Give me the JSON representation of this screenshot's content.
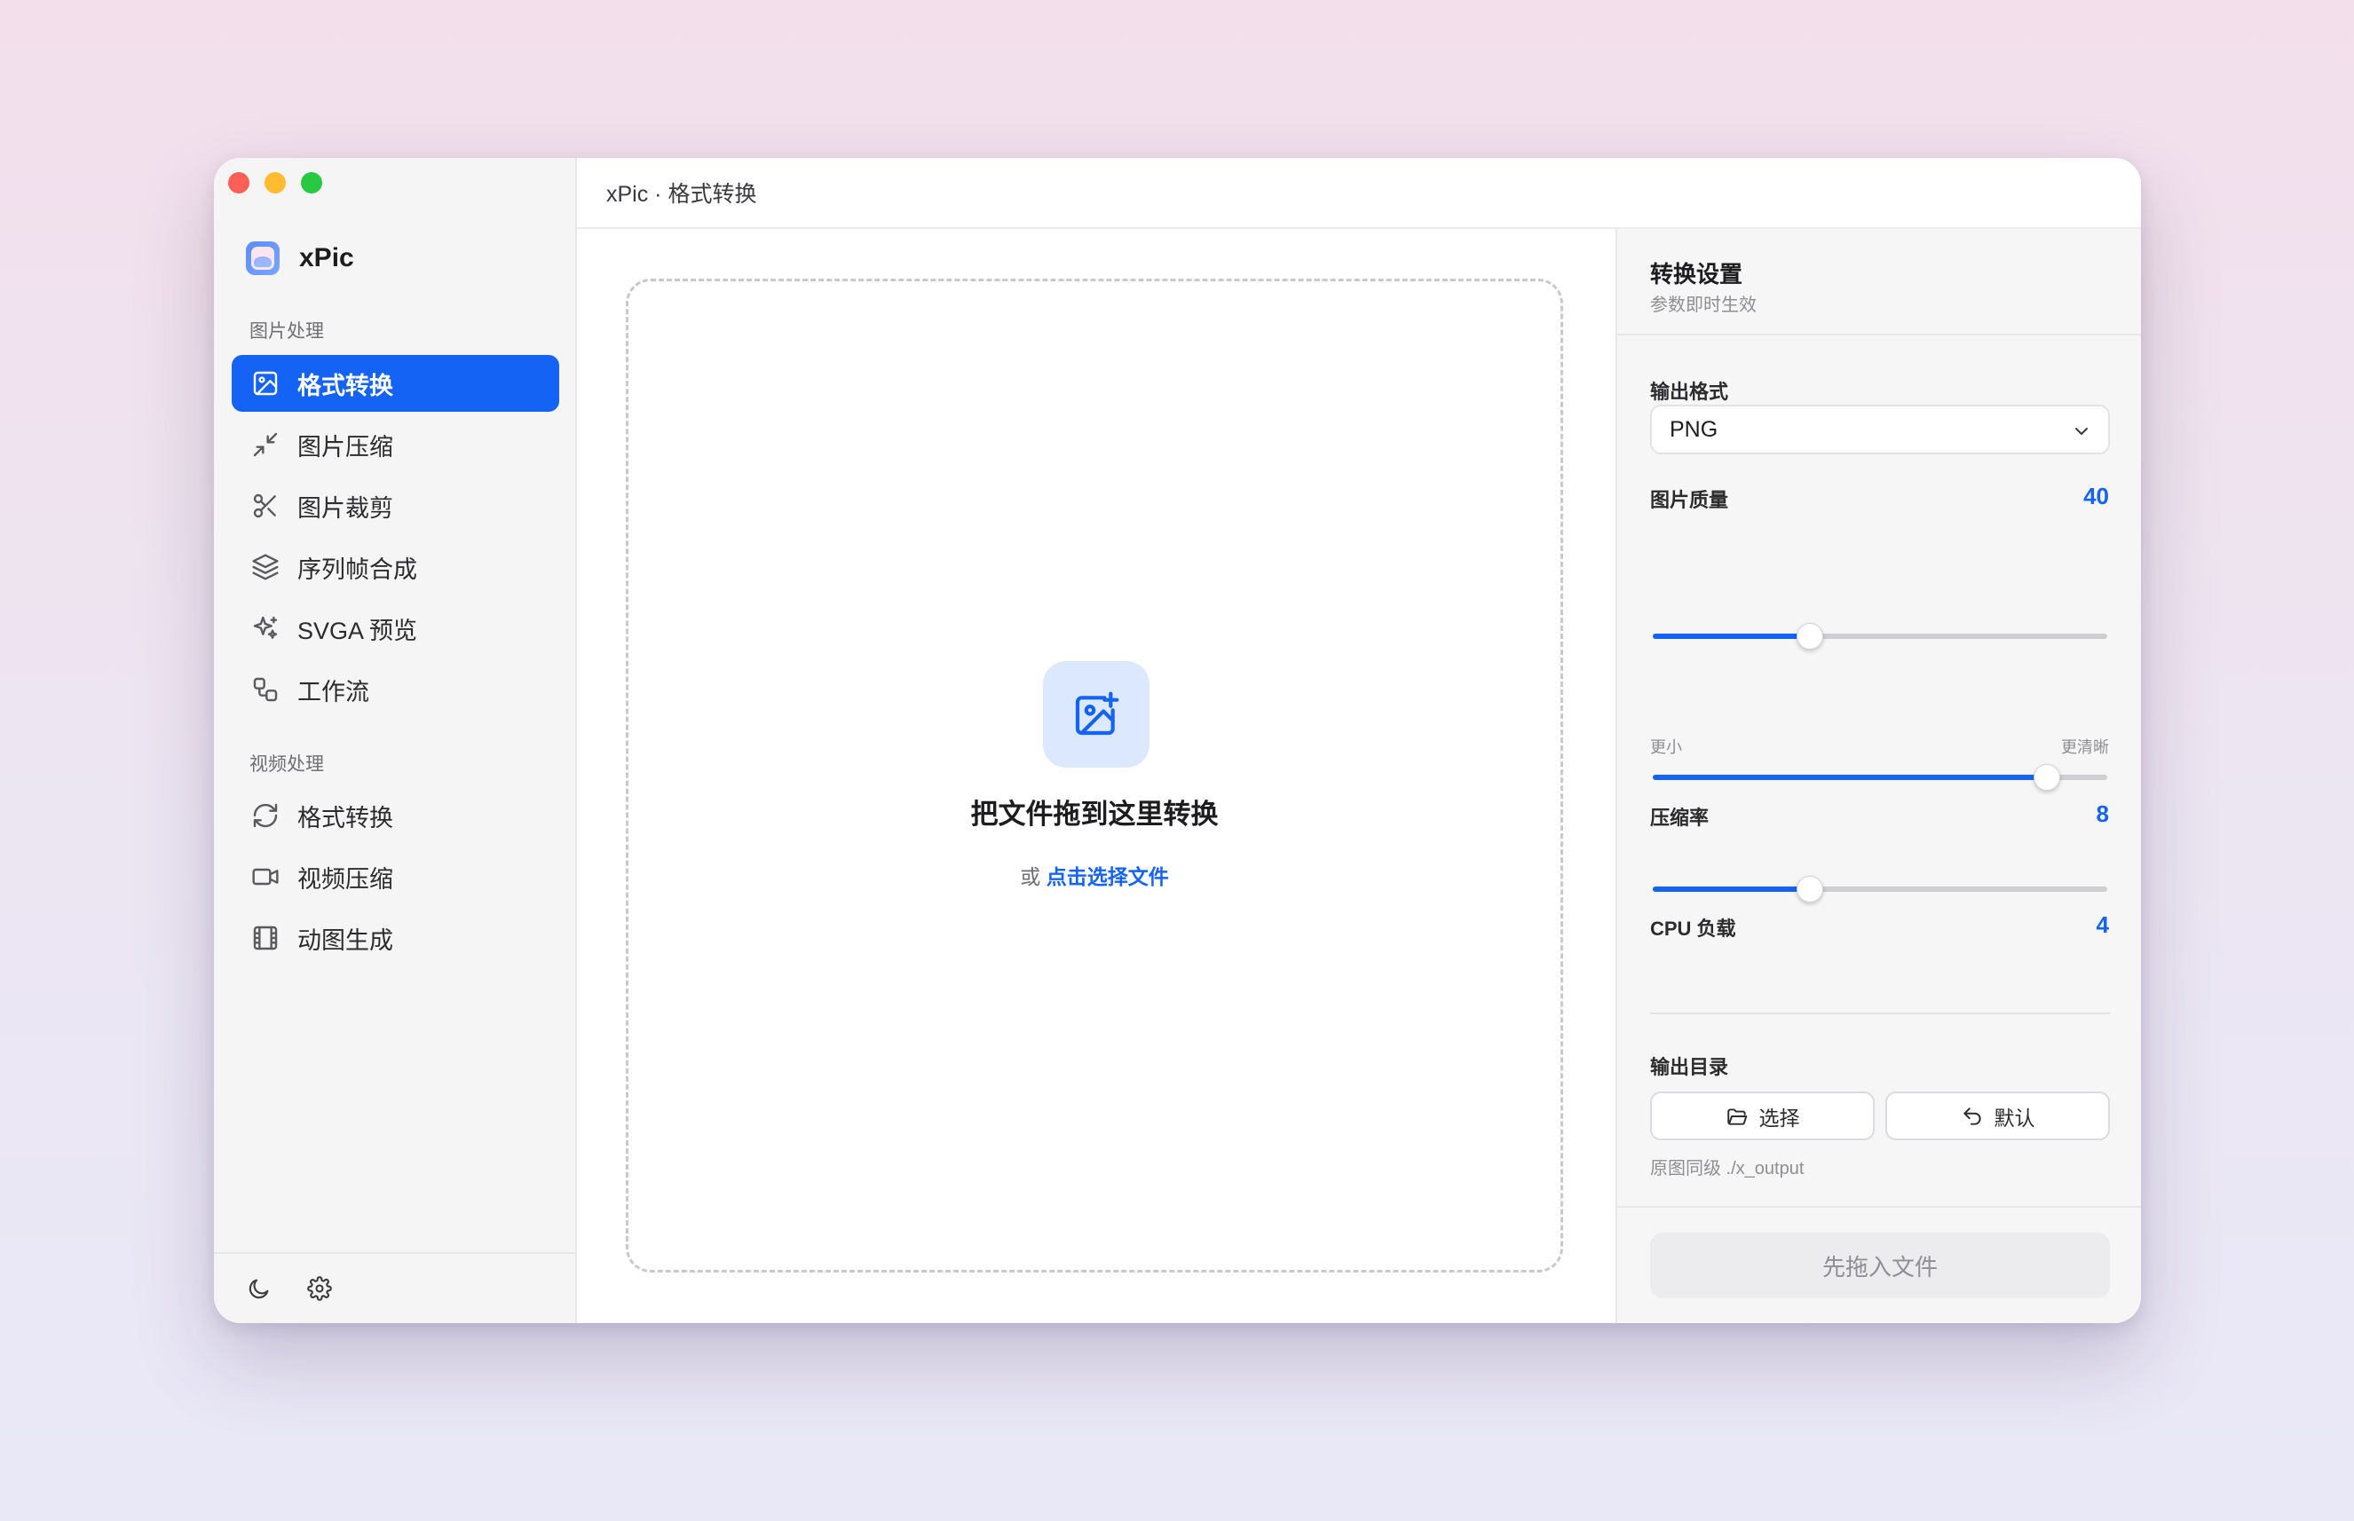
{
  "window": {
    "title": "xPic · 格式转换"
  },
  "sidebar": {
    "app_name": "xPic",
    "image_section_title": "图片处理",
    "image_items": [
      {
        "label": "格式转换",
        "icon": "image-icon",
        "active": true
      },
      {
        "label": "图片压缩",
        "icon": "compress-arrows-icon",
        "active": false
      },
      {
        "label": "图片裁剪",
        "icon": "scissors-icon",
        "active": false
      },
      {
        "label": "序列帧合成",
        "icon": "layers-icon",
        "active": false
      },
      {
        "label": "SVGA 预览",
        "icon": "sparkles-icon",
        "active": false
      },
      {
        "label": "工作流",
        "icon": "workflow-icon",
        "active": false
      }
    ],
    "video_section_title": "视频处理",
    "video_items": [
      {
        "label": "格式转换",
        "icon": "refresh-icon",
        "active": false
      },
      {
        "label": "视频压缩",
        "icon": "video-camera-icon",
        "active": false
      },
      {
        "label": "动图生成",
        "icon": "film-icon",
        "active": false
      }
    ],
    "footer_icons": [
      "moon-icon",
      "gear-icon"
    ]
  },
  "dropzone": {
    "title": "把文件拖到这里转换",
    "or_text": "或",
    "link_text": "点击选择文件"
  },
  "settings": {
    "title": "转换设置",
    "subtitle": "参数即时生效",
    "format_label": "输出格式",
    "format_value": "PNG",
    "quality_label": "图片质量",
    "quality_value": "40",
    "quality_fraction": 0.345,
    "quality_hint_left": "更小",
    "quality_hint_right": "更清晰",
    "compression_label": "压缩率",
    "compression_value": "8",
    "compression_fraction": 0.867,
    "cpu_label": "CPU 负载",
    "cpu_value": "4",
    "cpu_fraction": 0.345,
    "output_dir_label": "输出目录",
    "choose_button": "选择",
    "default_button": "默认",
    "output_path": "原图同级 ./x_output",
    "primary_button": "先拖入文件"
  },
  "colors": {
    "accent": "#1563f5",
    "sidebar_bg": "#f5f5f6",
    "panel_bg": "#f6f6f7"
  }
}
